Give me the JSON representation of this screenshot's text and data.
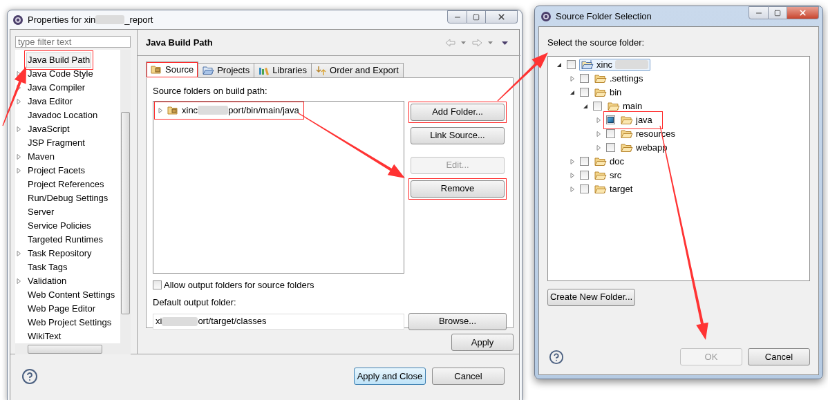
{
  "properties_dialog": {
    "title_prefix": "Properties for xin",
    "title_suffix": "_report",
    "filter": {
      "placeholder": "type filter text"
    },
    "tree": [
      {
        "label": "Java Build Path",
        "expandable": false,
        "selected": true,
        "highlighted": true
      },
      {
        "label": "Java Code Style",
        "expandable": true,
        "selected": false,
        "highlighted": false
      },
      {
        "label": "Java Compiler",
        "expandable": true,
        "selected": false,
        "highlighted": false
      },
      {
        "label": "Java Editor",
        "expandable": true,
        "selected": false,
        "highlighted": false
      },
      {
        "label": "Javadoc Location",
        "expandable": false,
        "selected": false,
        "highlighted": false
      },
      {
        "label": "JavaScript",
        "expandable": true,
        "selected": false,
        "highlighted": false
      },
      {
        "label": "JSP Fragment",
        "expandable": false,
        "selected": false,
        "highlighted": false
      },
      {
        "label": "Maven",
        "expandable": true,
        "selected": false,
        "highlighted": false
      },
      {
        "label": "Project Facets",
        "expandable": true,
        "selected": false,
        "highlighted": false
      },
      {
        "label": "Project References",
        "expandable": false,
        "selected": false,
        "highlighted": false
      },
      {
        "label": "Run/Debug Settings",
        "expandable": false,
        "selected": false,
        "highlighted": false
      },
      {
        "label": "Server",
        "expandable": false,
        "selected": false,
        "highlighted": false
      },
      {
        "label": "Service Policies",
        "expandable": false,
        "selected": false,
        "highlighted": false
      },
      {
        "label": "Targeted Runtimes",
        "expandable": false,
        "selected": false,
        "highlighted": false
      },
      {
        "label": "Task Repository",
        "expandable": true,
        "selected": false,
        "highlighted": false
      },
      {
        "label": "Task Tags",
        "expandable": false,
        "selected": false,
        "highlighted": false
      },
      {
        "label": "Validation",
        "expandable": true,
        "selected": false,
        "highlighted": false
      },
      {
        "label": "Web Content Settings",
        "expandable": false,
        "selected": false,
        "highlighted": false
      },
      {
        "label": "Web Page Editor",
        "expandable": false,
        "selected": false,
        "highlighted": false
      },
      {
        "label": "Web Project Settings",
        "expandable": false,
        "selected": false,
        "highlighted": false
      },
      {
        "label": "WikiText",
        "expandable": false,
        "selected": false,
        "highlighted": false
      }
    ],
    "page_title": "Java Build Path",
    "tabs": [
      {
        "label": "Source",
        "kind": "source",
        "selected": true,
        "highlighted": true
      },
      {
        "label": "Projects",
        "kind": "projects",
        "selected": false,
        "highlighted": false
      },
      {
        "label": "Libraries",
        "kind": "libraries",
        "selected": false,
        "highlighted": false
      },
      {
        "label": "Order and Export",
        "kind": "order",
        "selected": false,
        "highlighted": false
      }
    ],
    "source_label": "Source folders on build path:",
    "source_folders": [
      {
        "prefix": "xinc",
        "suffix": "port/bin/main/java",
        "highlighted": true
      }
    ],
    "buttons": [
      {
        "label": "Add Folder...",
        "disabled": false,
        "highlighted": true
      },
      {
        "label": "Link Source...",
        "disabled": false,
        "highlighted": false
      },
      {
        "label": "Edit...",
        "disabled": true,
        "highlighted": false
      },
      {
        "label": "Remove",
        "disabled": false,
        "highlighted": true
      }
    ],
    "allow_output": {
      "label": "Allow output folders for source folders",
      "checked": false
    },
    "output_label": "Default output folder:",
    "output_field": {
      "prefix": "xi",
      "suffix": "ort/target/classes"
    },
    "browse": "Browse...",
    "apply": "Apply",
    "footer_buttons": [
      {
        "label": "Apply and Close",
        "default": true
      },
      {
        "label": "Cancel",
        "default": false
      }
    ]
  },
  "folder_dialog": {
    "title": "Source Folder Selection",
    "label": "Select the source folder:",
    "tree": [
      {
        "label": "xinc",
        "kind": "project",
        "checked": false,
        "expanded": true,
        "selected": true,
        "highlighted": false,
        "children": [
          {
            "label": ".settings",
            "kind": "folder",
            "checked": false,
            "expanded": false,
            "selected": false,
            "highlighted": false
          },
          {
            "label": "bin",
            "kind": "folder",
            "checked": false,
            "expanded": true,
            "selected": false,
            "highlighted": false,
            "children": [
              {
                "label": "main",
                "kind": "folder",
                "checked": false,
                "expanded": true,
                "selected": false,
                "highlighted": false,
                "children": [
                  {
                    "label": "java",
                    "kind": "folder",
                    "checked": true,
                    "expanded": false,
                    "selected": false,
                    "highlighted": true
                  },
                  {
                    "label": "resources",
                    "kind": "folder",
                    "checked": false,
                    "expanded": false,
                    "selected": false,
                    "highlighted": false
                  },
                  {
                    "label": "webapp",
                    "kind": "folder",
                    "checked": false,
                    "expanded": false,
                    "selected": false,
                    "highlighted": false
                  }
                ]
              }
            ]
          },
          {
            "label": "doc",
            "kind": "folder",
            "checked": false,
            "expanded": false,
            "selected": false,
            "highlighted": false
          },
          {
            "label": "src",
            "kind": "folder",
            "checked": false,
            "expanded": false,
            "selected": false,
            "highlighted": false
          },
          {
            "label": "target",
            "kind": "folder",
            "checked": false,
            "expanded": false,
            "selected": false,
            "highlighted": false
          }
        ]
      }
    ],
    "create_button": "Create New Folder...",
    "footer_buttons": [
      {
        "label": "OK",
        "disabled": true
      },
      {
        "label": "Cancel",
        "disabled": false
      }
    ]
  }
}
